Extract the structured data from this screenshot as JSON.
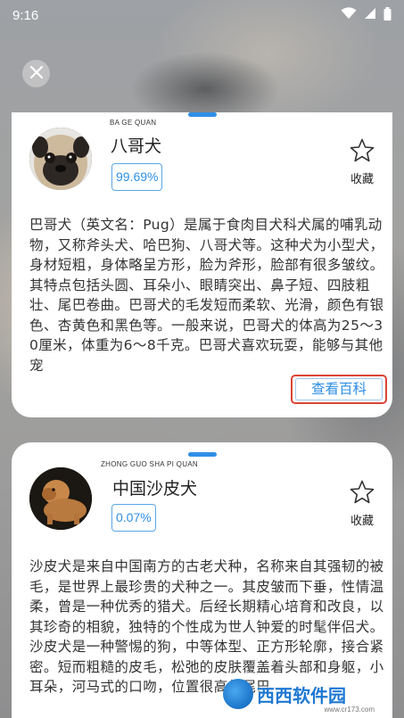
{
  "status_bar": {
    "time": "9:16",
    "icons": [
      "wifi-icon",
      "signal-icon",
      "battery-icon"
    ]
  },
  "colors": {
    "accent": "#2f8fe6",
    "highlight_border": "#d94535",
    "card_bg": "#ffffff"
  },
  "cards": [
    {
      "pinyin": "BA GE QUAN",
      "name": "八哥犬",
      "confidence": "99.69%",
      "favorite_label": "收藏",
      "description": "巴哥犬（英文名：Pug）是属于食肉目犬科犬属的哺乳动物，又称斧头犬、哈巴狗、八哥犬等。这种犬为小型犬，身材短粗，身体略呈方形，脸为斧形，脸部有很多皱纹。其特点包括头圆、耳朵小、眼睛突出、鼻子短、四肢粗壮、尾巴卷曲。巴哥犬的毛发短而柔软、光滑，颜色有银色、杏黄色和黑色等。一般来说，巴哥犬的体高为25～30厘米，体重为6～8千克。巴哥犬喜欢玩耍，能够与其他宠",
      "wiki_button": "查看百科"
    },
    {
      "pinyin": "ZHONG GUO SHA PI QUAN",
      "name": "中国沙皮犬",
      "confidence": "0.07%",
      "favorite_label": "收藏",
      "description": "沙皮犬是来自中国南方的古老犬种，名称来自其强韧的被毛，是世界上最珍贵的犬种之一。其皮皱而下垂，性情温柔，曾是一种优秀的猎犬。后经长期精心培育和改良，以其珍奇的相貌，独特的个性成为世人钟爱的时髦伴侣犬。沙皮犬是一种警惕的狗，中等体型、正方形轮廓，接合紧密。短而粗糙的皮毛，松弛的皮肤覆盖着头部和身躯，小耳朵，河马式的口吻，位置很高的尾巴"
    }
  ],
  "watermark": {
    "text": "西西软件园",
    "sub": "www.cr173.com"
  }
}
